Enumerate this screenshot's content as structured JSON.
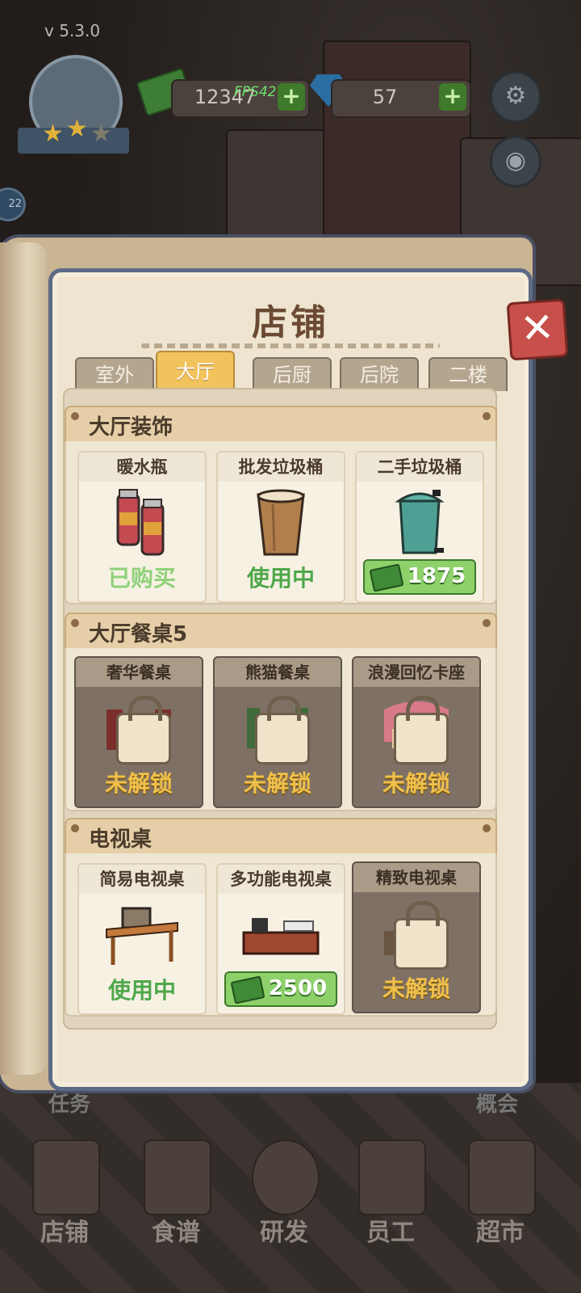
{
  "hud": {
    "version": "v 5.3.0",
    "fps": "FPS42",
    "cash": "12347",
    "gems": "57",
    "plus": "+"
  },
  "left_badge": "22",
  "panel": {
    "title": "店铺",
    "close": "✕",
    "tabs": [
      "室外",
      "大厅",
      "后厨",
      "后院",
      "二楼"
    ],
    "active_tab": "大厅"
  },
  "sections": [
    {
      "title": "大厅装饰",
      "items": [
        {
          "name": "暖水瓶",
          "status": "已购买"
        },
        {
          "name": "批发垃圾桶",
          "status": "使用中"
        },
        {
          "name": "二手垃圾桶",
          "price": "1875"
        }
      ]
    },
    {
      "title": "大厅餐桌5",
      "items": [
        {
          "name": "奢华餐桌",
          "status": "未解锁"
        },
        {
          "name": "熊猫餐桌",
          "status": "未解锁"
        },
        {
          "name": "浪漫回忆卡座",
          "status": "未解锁"
        }
      ]
    },
    {
      "title": "电视桌",
      "items": [
        {
          "name": "简易电视桌",
          "status": "使用中"
        },
        {
          "name": "多功能电视桌",
          "price": "2500"
        },
        {
          "name": "精致电视桌",
          "status": "未解锁"
        }
      ]
    }
  ],
  "bottom_nav": [
    "店铺",
    "食谱",
    "研发",
    "员工",
    "超市"
  ],
  "partial_labels": {
    "left": "任务",
    "right": "概会"
  }
}
